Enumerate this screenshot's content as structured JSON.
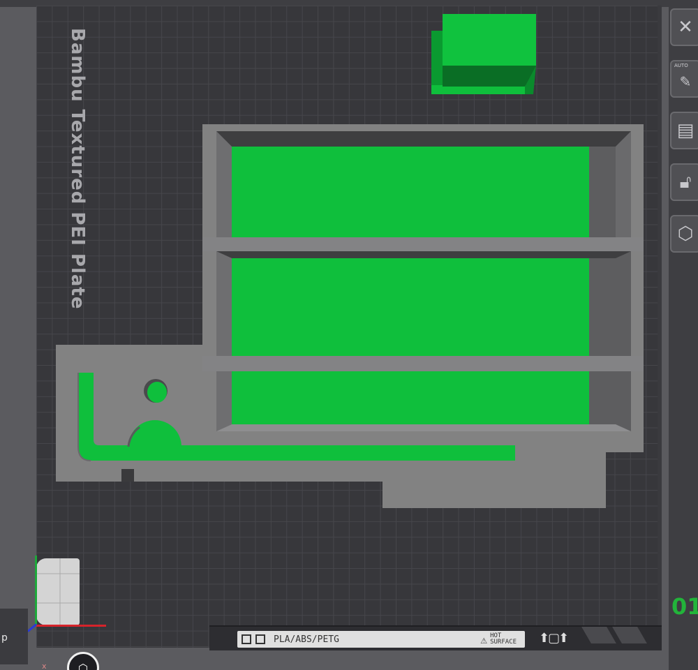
{
  "plate": {
    "name": "Bambu Textured PEI Plate",
    "number": "01",
    "material_label": "PLA/ABS/PETG",
    "hot_label_line1": "HOT",
    "hot_label_line2": "SURFACE"
  },
  "toolbar": {
    "items": [
      {
        "name": "close",
        "icon": "close-icon"
      },
      {
        "name": "auto-orient",
        "icon": "auto-orient-icon",
        "label": "AUTO"
      },
      {
        "name": "arrange",
        "icon": "arrange-icon"
      },
      {
        "name": "lock",
        "icon": "lock-icon"
      },
      {
        "name": "settings",
        "icon": "hex-nut-icon"
      }
    ]
  },
  "overlay": {
    "tooltip_text": "p",
    "axis_x_label": "x"
  },
  "colors": {
    "background": "#5b5b5f",
    "plate": "#37373b",
    "grid": "#46464b",
    "model_selected": "#0fbf3c",
    "model_grey": "#828282",
    "accent": "#22b43a"
  }
}
